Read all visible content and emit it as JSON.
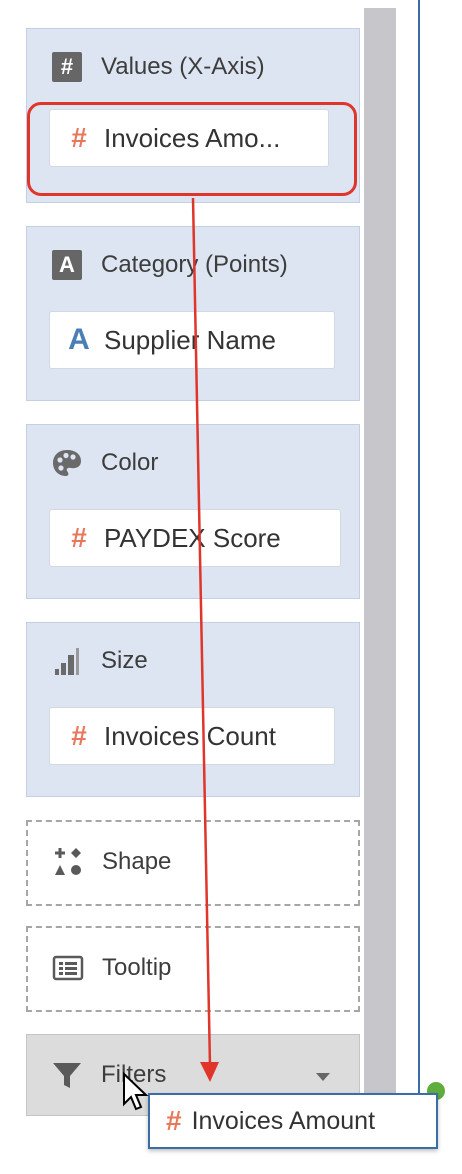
{
  "panel": {
    "values": {
      "label": "Values (X-Axis)",
      "icon": "hash-box-icon",
      "item": "Invoices Amo..."
    },
    "category": {
      "label": "Category (Points)",
      "icon": "a-box-icon",
      "item": "Supplier Name"
    },
    "color": {
      "label": "Color",
      "icon": "palette-icon",
      "item": "PAYDEX Score"
    },
    "size": {
      "label": "Size",
      "icon": "size-bars-icon",
      "item": "Invoices Count"
    },
    "shape": {
      "label": "Shape",
      "icon": "shapes-icon"
    },
    "tooltip": {
      "label": "Tooltip",
      "icon": "tooltip-icon"
    },
    "filters": {
      "label": "Filters",
      "icon": "funnel-icon"
    }
  },
  "drag": {
    "item": "Invoices Amount"
  },
  "colors": {
    "highlight": "#e0352b",
    "measure": "#e8775b",
    "attribute": "#4a7fb5",
    "canvas_border": "#3a6ea8"
  }
}
